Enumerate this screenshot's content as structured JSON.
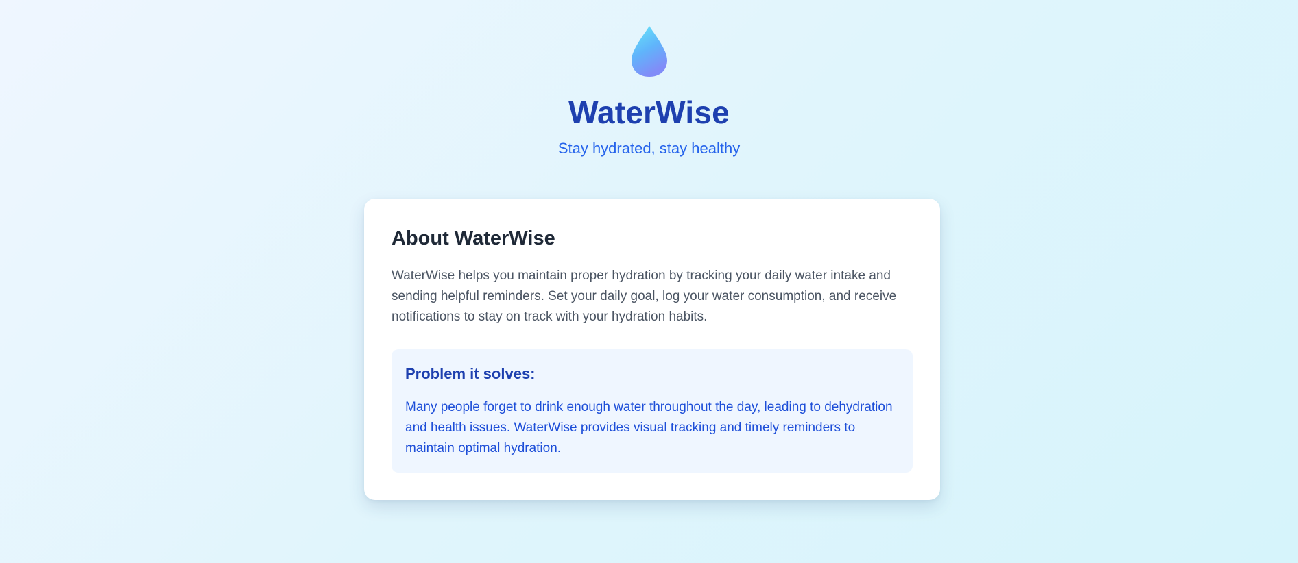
{
  "header": {
    "logo_icon": "water-drop-icon",
    "title": "WaterWise",
    "tagline": "Stay hydrated, stay healthy"
  },
  "about": {
    "title": "About WaterWise",
    "description": "WaterWise helps you maintain proper hydration by tracking your daily water intake and sending helpful reminders. Set your daily goal, log your water consumption, and receive notifications to stay on track with your hydration habits.",
    "problem": {
      "title": "Problem it solves:",
      "description": "Many people forget to drink enough water throughout the day, leading to dehydration and health issues. WaterWise provides visual tracking and timely reminders to maintain optimal hydration."
    }
  },
  "colors": {
    "brand": "#1e40af",
    "accent": "#2563eb",
    "drop_top": "#67e8f9",
    "drop_bottom": "#818cf8"
  }
}
